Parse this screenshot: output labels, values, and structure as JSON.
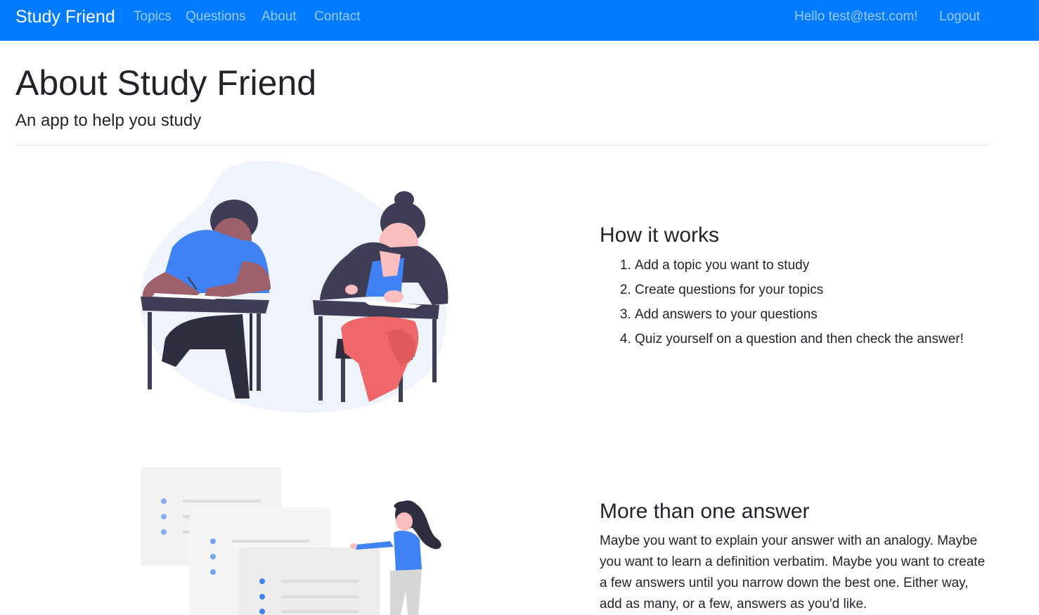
{
  "nav": {
    "brand": "Study Friend",
    "links": [
      "Topics",
      "Questions",
      "About",
      "Contact"
    ],
    "greeting": "Hello test@test.com!",
    "logout": "Logout"
  },
  "header": {
    "title": "About Study Friend",
    "lead": "An app to help you study"
  },
  "how_it_works": {
    "heading": "How it works",
    "steps": [
      "Add a topic you want to study",
      "Create questions for your topics",
      "Add answers to your questions",
      "Quiz yourself on a question and then check the answer!"
    ]
  },
  "more_answers": {
    "heading": "More than one answer",
    "body": "Maybe you want to explain your answer with an analogy. Maybe you want to learn a definition verbatim. Maybe you want to create a few answers until you narrow down the best one. Either way, add as many, or a few, answers as you'd like."
  },
  "colors": {
    "navbar": "#007bff",
    "accent_blue": "#3f82f6",
    "skin_dark": "#9e616a",
    "skin_light": "#fbbebe",
    "hair": "#3f3d56",
    "pants_red": "#f0676a",
    "blob": "#eef3fc"
  }
}
